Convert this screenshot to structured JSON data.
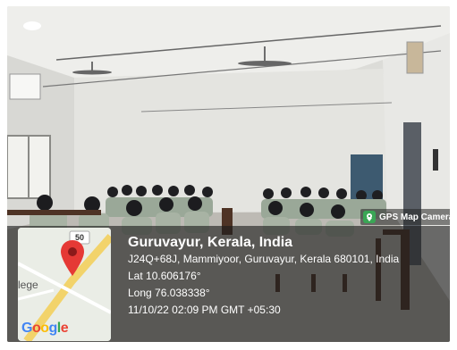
{
  "photo": {
    "description": "",
    "colors": {
      "wall": "#e6e6e2",
      "ceiling": "#efefec",
      "floor": "#bfbcb6",
      "door": "#3c5a70",
      "uniform_sage": "#9aa898",
      "desk_wood": "#5a3b2a"
    }
  },
  "gps_badge": {
    "icon": "gps-map-camera-icon",
    "label": "GPS Map Camera"
  },
  "map_thumbnail": {
    "route_number": "50",
    "place_fragment": "lege",
    "map_provider": "Google",
    "pin_icon": "location-pin-icon"
  },
  "location": {
    "place": "Guruvayur, Kerala, India",
    "address": "J24Q+68J, Mammiyoor, Guruvayur, Kerala 680101, India",
    "latitude": "Lat 10.606176°",
    "longitude": "Long 76.038338°",
    "timestamp": "11/10/22 02:09 PM GMT +05:30"
  }
}
